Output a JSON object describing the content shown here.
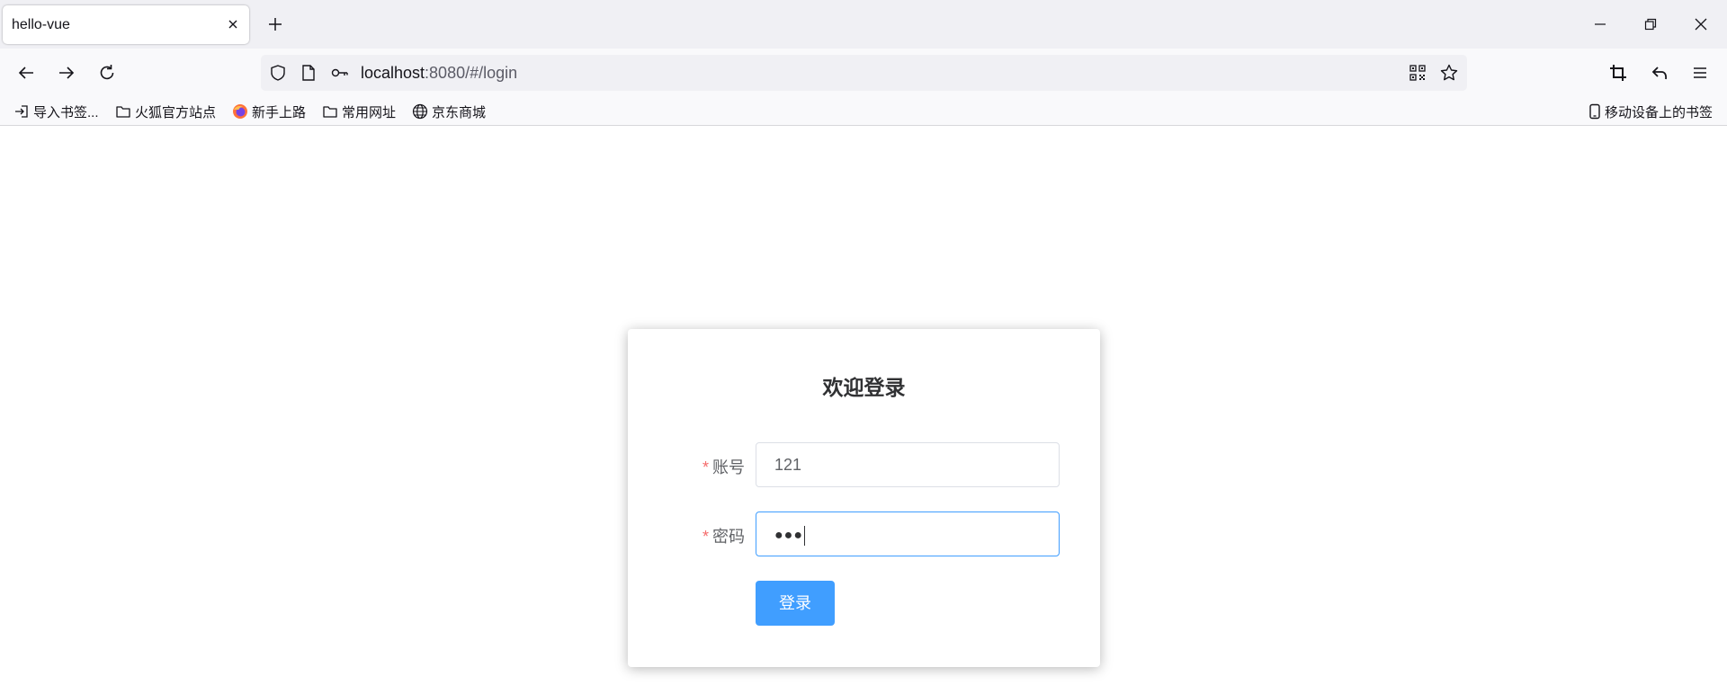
{
  "browser": {
    "tab": {
      "title": "hello-vue"
    },
    "address": {
      "host": "localhost",
      "rest": ":8080/#/login"
    },
    "bookmarks": [
      {
        "label": "导入书签...",
        "icon": "import-icon"
      },
      {
        "label": "火狐官方站点",
        "icon": "folder-icon"
      },
      {
        "label": "新手上路",
        "icon": "firefox-icon"
      },
      {
        "label": "常用网址",
        "icon": "folder-icon"
      },
      {
        "label": "京东商城",
        "icon": "globe-icon"
      }
    ],
    "mobile_bookmarks": "移动设备上的书签"
  },
  "login": {
    "title": "欢迎登录",
    "required_mark": "*",
    "account_label": "账号",
    "account_value": "121",
    "password_label": "密码",
    "password_value": "●●●",
    "submit_label": "登录"
  },
  "colors": {
    "primary": "#409eff",
    "required": "#f56c6c",
    "input_border": "#dcdfe6"
  }
}
